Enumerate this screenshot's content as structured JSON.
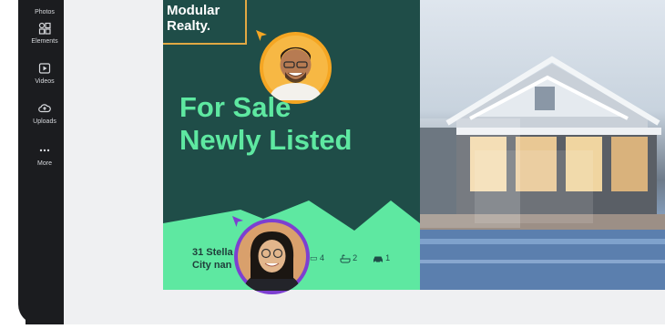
{
  "sidebar": {
    "items": [
      {
        "label": "Photos",
        "icon": "photos-icon"
      },
      {
        "label": "Elements",
        "icon": "elements-icon"
      },
      {
        "label": "Videos",
        "icon": "videos-icon"
      },
      {
        "label": "Uploads",
        "icon": "uploads-icon"
      },
      {
        "label": "More",
        "icon": "more-icon"
      }
    ]
  },
  "design": {
    "logo_line1": "Modular",
    "logo_line2": "Realty.",
    "headline_line1": "For Sale",
    "headline_line2": "Newly Listed",
    "address_line1": "31 Stella",
    "address_line2": "City nan",
    "stats": [
      {
        "icon": "bed-icon",
        "value": "4"
      },
      {
        "icon": "bath-icon",
        "value": "2"
      },
      {
        "icon": "car-icon",
        "value": "1"
      }
    ],
    "colors": {
      "panel": "#1f4d48",
      "accent_green": "#5ee8a1",
      "mint": "#6fd6a0",
      "logo_border": "#e1a843",
      "avatar_ring_orange": "#f5a623",
      "avatar_ring_purple": "#7d3fd1"
    }
  }
}
